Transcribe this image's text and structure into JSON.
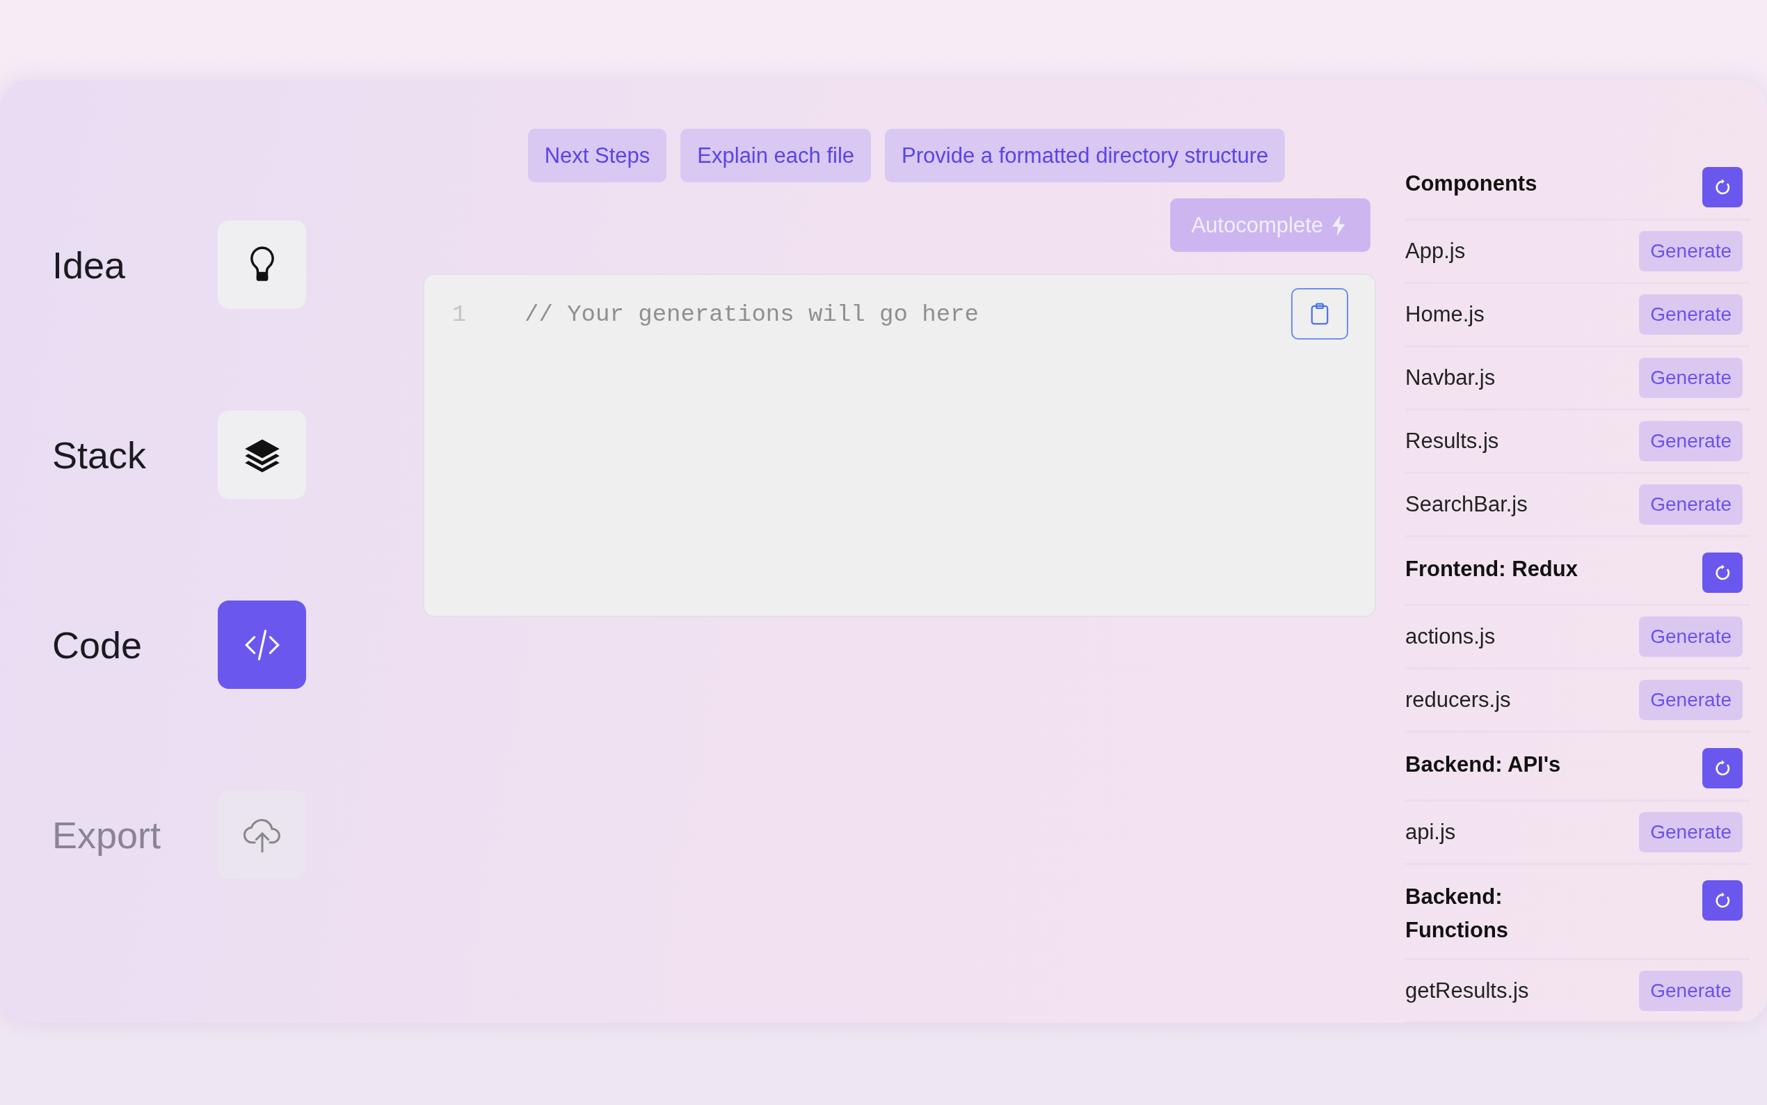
{
  "steps": [
    {
      "label": "Idea",
      "selected": false,
      "disabled": false
    },
    {
      "label": "Stack",
      "selected": false,
      "disabled": false
    },
    {
      "label": "Code",
      "selected": true,
      "disabled": false
    },
    {
      "label": "Export",
      "selected": false,
      "disabled": true
    }
  ],
  "prompt_buttons": [
    "Next Steps",
    "Explain each file",
    "Provide a formatted directory structure"
  ],
  "autocomplete_button": "Autocomplete",
  "editor": {
    "line_number": "1",
    "placeholder": "// Your generations will go here"
  },
  "file_groups": [
    {
      "title": "Components",
      "files": [
        {
          "name": "App.js",
          "button": "Generate"
        },
        {
          "name": "Home.js",
          "button": "Generate"
        },
        {
          "name": "Navbar.js",
          "button": "Generate"
        },
        {
          "name": "Results.js",
          "button": "Generate"
        },
        {
          "name": "SearchBar.js",
          "button": "Generate"
        }
      ]
    },
    {
      "title": "Frontend: Redux",
      "files": [
        {
          "name": "actions.js",
          "button": "Generate"
        },
        {
          "name": "reducers.js",
          "button": "Generate"
        }
      ]
    },
    {
      "title": "Backend: API's",
      "files": [
        {
          "name": "api.js",
          "button": "Generate"
        }
      ]
    },
    {
      "title": "Backend: Functions",
      "files": [
        {
          "name": "getResults.js",
          "button": "Generate"
        }
      ]
    }
  ]
}
